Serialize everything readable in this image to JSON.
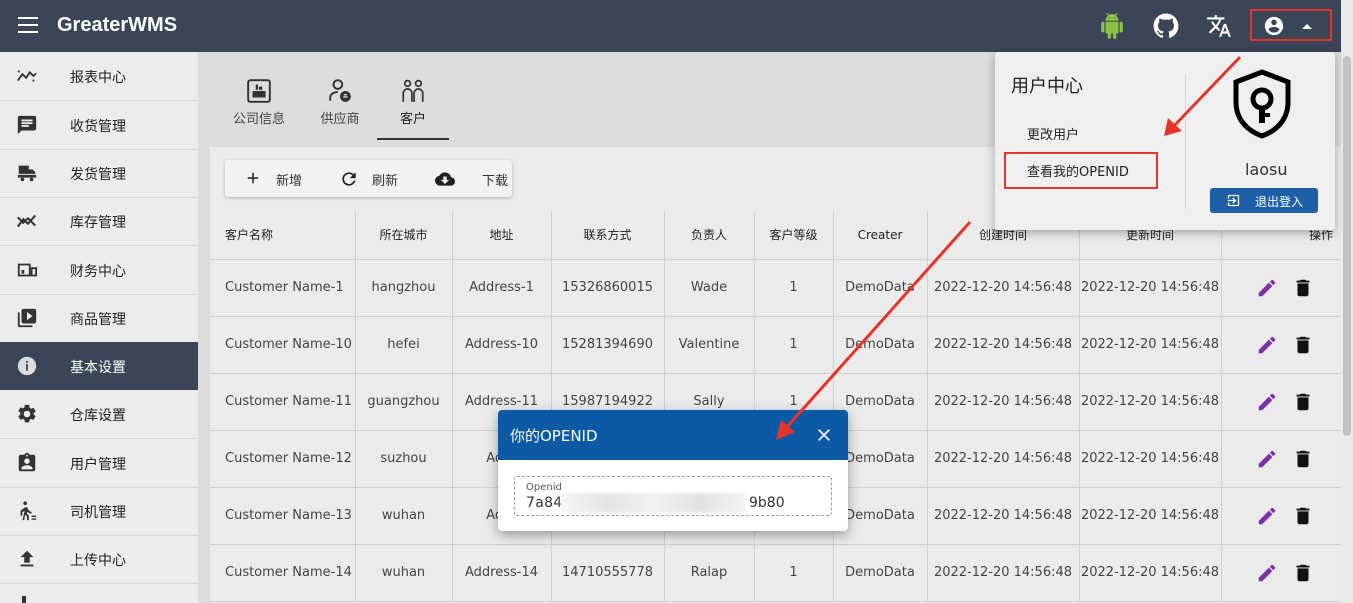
{
  "app": {
    "title": "GreaterWMS"
  },
  "topbar_icons": [
    "android-icon",
    "github-icon",
    "translate-icon",
    "account-circle-icon"
  ],
  "sidebar": {
    "items": [
      {
        "label": "报表中心",
        "icon": "trend-icon",
        "active": false
      },
      {
        "label": "收货管理",
        "icon": "message-icon",
        "active": false
      },
      {
        "label": "发货管理",
        "icon": "truck-icon",
        "active": false
      },
      {
        "label": "库存管理",
        "icon": "chart-icon",
        "active": false
      },
      {
        "label": "财务中心",
        "icon": "devices-icon",
        "active": false
      },
      {
        "label": "商品管理",
        "icon": "video-library-icon",
        "active": false
      },
      {
        "label": "基本设置",
        "icon": "info-icon",
        "active": true
      },
      {
        "label": "仓库设置",
        "icon": "gear-icon",
        "active": false
      },
      {
        "label": "用户管理",
        "icon": "badge-icon",
        "active": false
      },
      {
        "label": "司机管理",
        "icon": "walk-icon",
        "active": false
      },
      {
        "label": "上传中心",
        "icon": "upload-icon",
        "active": false
      }
    ]
  },
  "tabs": [
    {
      "label": "公司信息",
      "icon": "company-icon"
    },
    {
      "label": "供应商",
      "icon": "supplier-icon"
    },
    {
      "label": "客户",
      "icon": "customers-icon",
      "active": true
    }
  ],
  "toolbar": {
    "new_label": "新增",
    "refresh_label": "刷新",
    "download_label": "下载"
  },
  "table": {
    "columns": [
      "客户名称",
      "所在城市",
      "地址",
      "联系方式",
      "负责人",
      "客户等级",
      "Creater",
      "创建时间",
      "更新时间",
      "操作"
    ],
    "rows": [
      [
        "Customer Name-1",
        "hangzhou",
        "Address-1",
        "15326860015",
        "Wade",
        "1",
        "DemoData",
        "2022-12-20 14:56:48",
        "2022-12-20 14:56:48"
      ],
      [
        "Customer Name-10",
        "hefei",
        "Address-10",
        "15281394690",
        "Valentine",
        "1",
        "DemoData",
        "2022-12-20 14:56:48",
        "2022-12-20 14:56:48"
      ],
      [
        "Customer Name-11",
        "guangzhou",
        "Address-11",
        "15987194922",
        "Sally",
        "1",
        "DemoData",
        "2022-12-20 14:56:48",
        "2022-12-20 14:56:48"
      ],
      [
        "Customer Name-12",
        "suzhou",
        "Addr",
        "",
        "",
        "",
        "DemoData",
        "2022-12-20 14:56:48",
        "2022-12-20 14:56:48"
      ],
      [
        "Customer Name-13",
        "wuhan",
        "Addr",
        "",
        "",
        "",
        "DemoData",
        "2022-12-20 14:56:48",
        "2022-12-20 14:56:48"
      ],
      [
        "Customer Name-14",
        "wuhan",
        "Address-14",
        "14710555778",
        "Ralap",
        "1",
        "DemoData",
        "2022-12-20 14:56:48",
        "2022-12-20 14:56:48"
      ]
    ]
  },
  "user_menu": {
    "title": "用户中心",
    "change_user_label": "更改用户",
    "view_openid_label": "查看我的OPENID",
    "username": "laosu",
    "logout_label": "退出登入"
  },
  "dialog": {
    "title": "你的OPENID",
    "field_label": "Openid",
    "value_prefix": "7a84",
    "value_suffix": "9b80"
  },
  "colors": {
    "topbar": "#3a4558",
    "accent": "#1e60a8",
    "highlight": "#e5342a",
    "edit": "#7b2fa8"
  }
}
